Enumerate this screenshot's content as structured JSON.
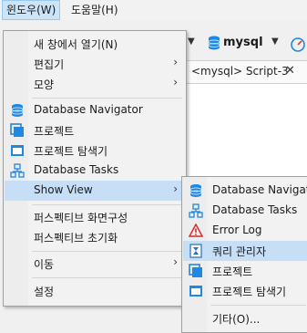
{
  "menubar": {
    "window_label": "윈도우(W)",
    "help_label": "도움말(H)"
  },
  "toolbar": {
    "connection": "mysql"
  },
  "editor_tab": {
    "label": "<mysql> Script-3"
  },
  "window_menu": {
    "items": [
      {
        "label": "새 창에서 열기(N)"
      },
      {
        "label": "편집기"
      },
      {
        "label": "모양"
      },
      {
        "label": "Database Navigator"
      },
      {
        "label": "프로젝트"
      },
      {
        "label": "프로젝트 탐색기"
      },
      {
        "label": "Database Tasks"
      },
      {
        "label": "Show View"
      },
      {
        "label": "퍼스펙티브 화면구성"
      },
      {
        "label": "퍼스펙티브 초기화"
      },
      {
        "label": "이동"
      },
      {
        "label": "설정"
      }
    ]
  },
  "show_view_menu": {
    "items": [
      {
        "label": "Database Navigator"
      },
      {
        "label": "Database Tasks"
      },
      {
        "label": "Error Log"
      },
      {
        "label": "쿼리 관리자"
      },
      {
        "label": "프로젝트"
      },
      {
        "label": "프로젝트 탐색기"
      },
      {
        "label": "기타(O)..."
      }
    ]
  },
  "colors": {
    "highlight": "#c6dff7",
    "menu_bg": "#f2f2f2",
    "accent_blue": "#1e88e5",
    "error_red": "#d32f2f"
  }
}
